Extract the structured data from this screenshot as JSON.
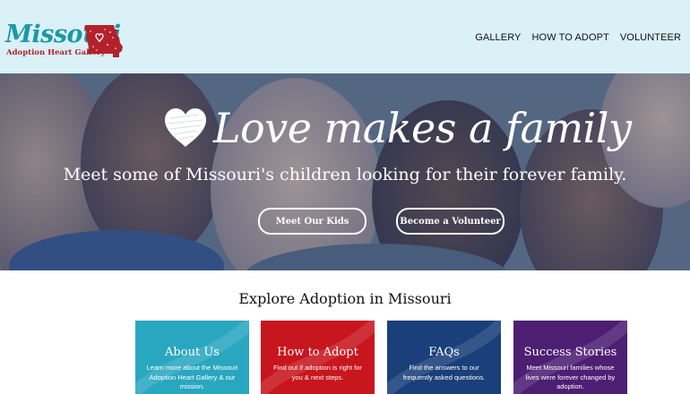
{
  "logo": {
    "title": "Missouri",
    "subtitle": "Adoption Heart Gallery",
    "map_color": "#b3222c",
    "title_color": "#1d97a8"
  },
  "nav": {
    "items": [
      "GALLERY",
      "HOW TO ADOPT",
      "VOLUNTEER"
    ]
  },
  "hero": {
    "title": "Love makes a family",
    "subtitle": "Meet some of Missouri's children looking for their forever family.",
    "buttons": {
      "kids": "Meet Our Kids",
      "volunteer": "Become a Volunteer"
    }
  },
  "explore": {
    "title": "Explore Adoption in Missouri",
    "cards": [
      {
        "title": "About Us",
        "desc": "Learn more about the Missouri Adoption Heart Gallery & our mission.",
        "color": "#2aa7c0"
      },
      {
        "title": "How to Adopt",
        "desc": "Find out if adoption is right for you & next steps.",
        "color": "#c8161e"
      },
      {
        "title": "FAQs",
        "desc": "Find the answers to our frequently asked questions.",
        "color": "#1a3f7a"
      },
      {
        "title": "Success Stories",
        "desc": "Meet Missouri families whose lives were forever changed by adoption.",
        "color": "#4d1f73"
      }
    ]
  },
  "colors": {
    "header_bg": "#d9f1f7",
    "hero_overlay": "#263c64"
  }
}
